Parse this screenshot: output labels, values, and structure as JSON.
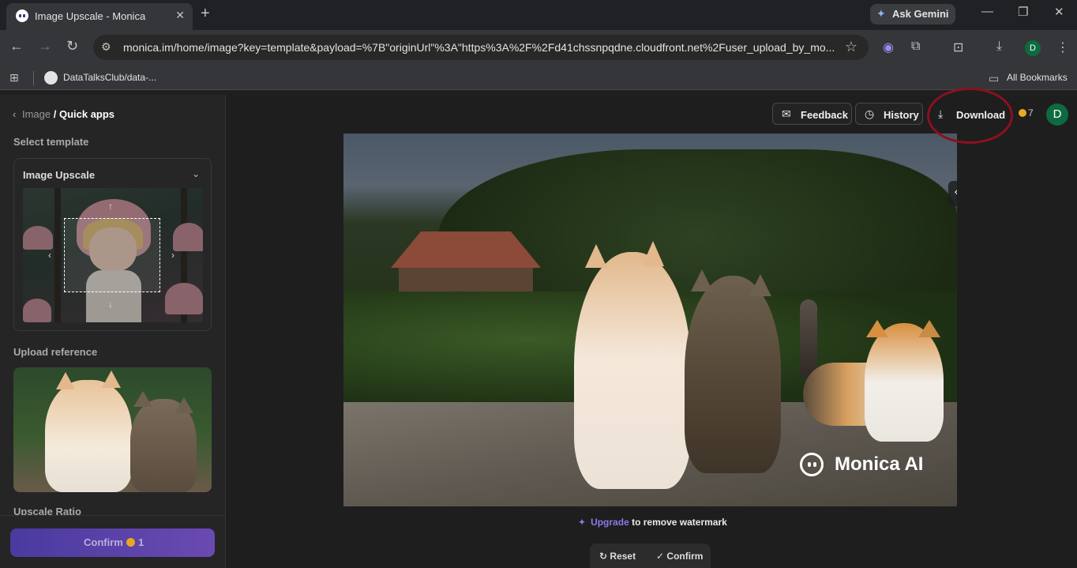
{
  "browser": {
    "tab_title": "Image Upscale - Monica",
    "new_tab": "+",
    "gemini_label": "Ask Gemini",
    "url": "monica.im/home/image?key=template&payload=%7B\"originUrl\"%3A\"https%3A%2F%2Fd41chssnpqdne.cloudfront.net%2Fuser_upload_by_mo...",
    "profile_initial": "D",
    "bookmark": "DataTalksClub/data-...",
    "all_bookmarks": "All Bookmarks"
  },
  "sidebar": {
    "breadcrumb_parent": "Image",
    "breadcrumb_current": "/ Quick apps",
    "select_template_label": "Select template",
    "template_name": "Image Upscale",
    "upload_reference_label": "Upload reference",
    "upscale_ratio_label": "Upscale Ratio",
    "confirm_label": "Confirm",
    "confirm_cost": "1"
  },
  "header": {
    "feedback_label": "Feedback",
    "history_label": "History",
    "download_label": "Download",
    "credits": "7",
    "avatar_initial": "D"
  },
  "main": {
    "watermark_text": "Monica AI",
    "upgrade_link": "Upgrade",
    "upgrade_suffix": " to remove watermark",
    "reset_label": "Reset",
    "confirm_label": "Confirm"
  },
  "colors": {
    "accent": "#8a7ae8",
    "highlight_circle": "#8c1020",
    "avatar_green": "#0d6b3f"
  }
}
